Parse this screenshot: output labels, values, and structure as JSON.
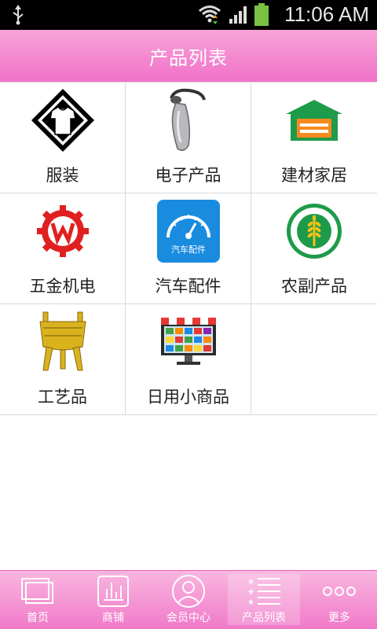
{
  "status_bar": {
    "time": "11:06 AM"
  },
  "header": {
    "title": "产品列表"
  },
  "grid": {
    "items": [
      {
        "label": "服装",
        "icon": "clothing-icon"
      },
      {
        "label": "电子产品",
        "icon": "bluetooth-headset-icon"
      },
      {
        "label": "建材家居",
        "icon": "house-icon"
      },
      {
        "label": "五金机电",
        "icon": "gear-logo-icon"
      },
      {
        "label": "汽车配件",
        "icon": "speedometer-icon",
        "badge": "汽车配件"
      },
      {
        "label": "农副产品",
        "icon": "wheat-seal-icon"
      },
      {
        "label": "工艺品",
        "icon": "bronze-vessel-icon"
      },
      {
        "label": "日用小商品",
        "icon": "shop-display-icon"
      }
    ]
  },
  "bottom_nav": {
    "items": [
      {
        "label": "首页",
        "icon": "home-pages-icon"
      },
      {
        "label": "商铺",
        "icon": "shop-chart-icon"
      },
      {
        "label": "会员中心",
        "icon": "member-avatar-icon"
      },
      {
        "label": "产品列表",
        "icon": "star-list-icon",
        "active": true
      },
      {
        "label": "更多",
        "icon": "more-dots-icon"
      }
    ]
  },
  "colors": {
    "accent_pink": "#f072c8",
    "header_top": "#f7a3d8",
    "grid_border": "#d9d9d9"
  }
}
